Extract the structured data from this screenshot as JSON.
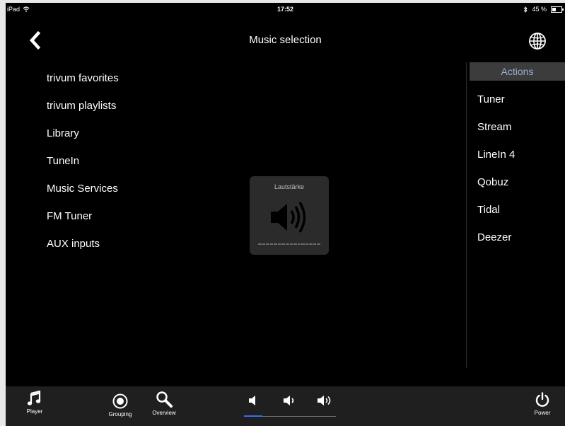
{
  "status_bar": {
    "device": "iPad",
    "time": "17:52",
    "battery_text": "45 %",
    "battery_level": 0.45
  },
  "nav": {
    "title": "Music selection",
    "back_icon": "chevron-left-icon",
    "globe_icon": "globe-icon"
  },
  "menu": {
    "items": [
      {
        "label": "trivum favorites"
      },
      {
        "label": "trivum playlists"
      },
      {
        "label": "Library"
      },
      {
        "label": "TuneIn"
      },
      {
        "label": "Music Services"
      },
      {
        "label": "FM Tuner"
      },
      {
        "label": "AUX inputs"
      }
    ]
  },
  "actions": {
    "header": "Actions",
    "items": [
      {
        "label": "Tuner"
      },
      {
        "label": "Stream"
      },
      {
        "label": "LineIn 4"
      },
      {
        "label": "Qobuz"
      },
      {
        "label": "Tidal"
      },
      {
        "label": "Deezer"
      }
    ]
  },
  "volume_hud": {
    "label": "Lautstärke",
    "icon": "speaker-loud-icon",
    "level": 0
  },
  "bottom_bar": {
    "player_label": "Player",
    "grouping_label": "Grouping",
    "overview_label": "Overview",
    "power_label": "Power",
    "volume_level": 0.2
  },
  "colors": {
    "background": "#000000",
    "bar": "#1f1f1f",
    "actions_header_bg": "#3c3c3c",
    "actions_header_text": "#9ab0d0",
    "volume_accent": "#3a6cf0"
  }
}
